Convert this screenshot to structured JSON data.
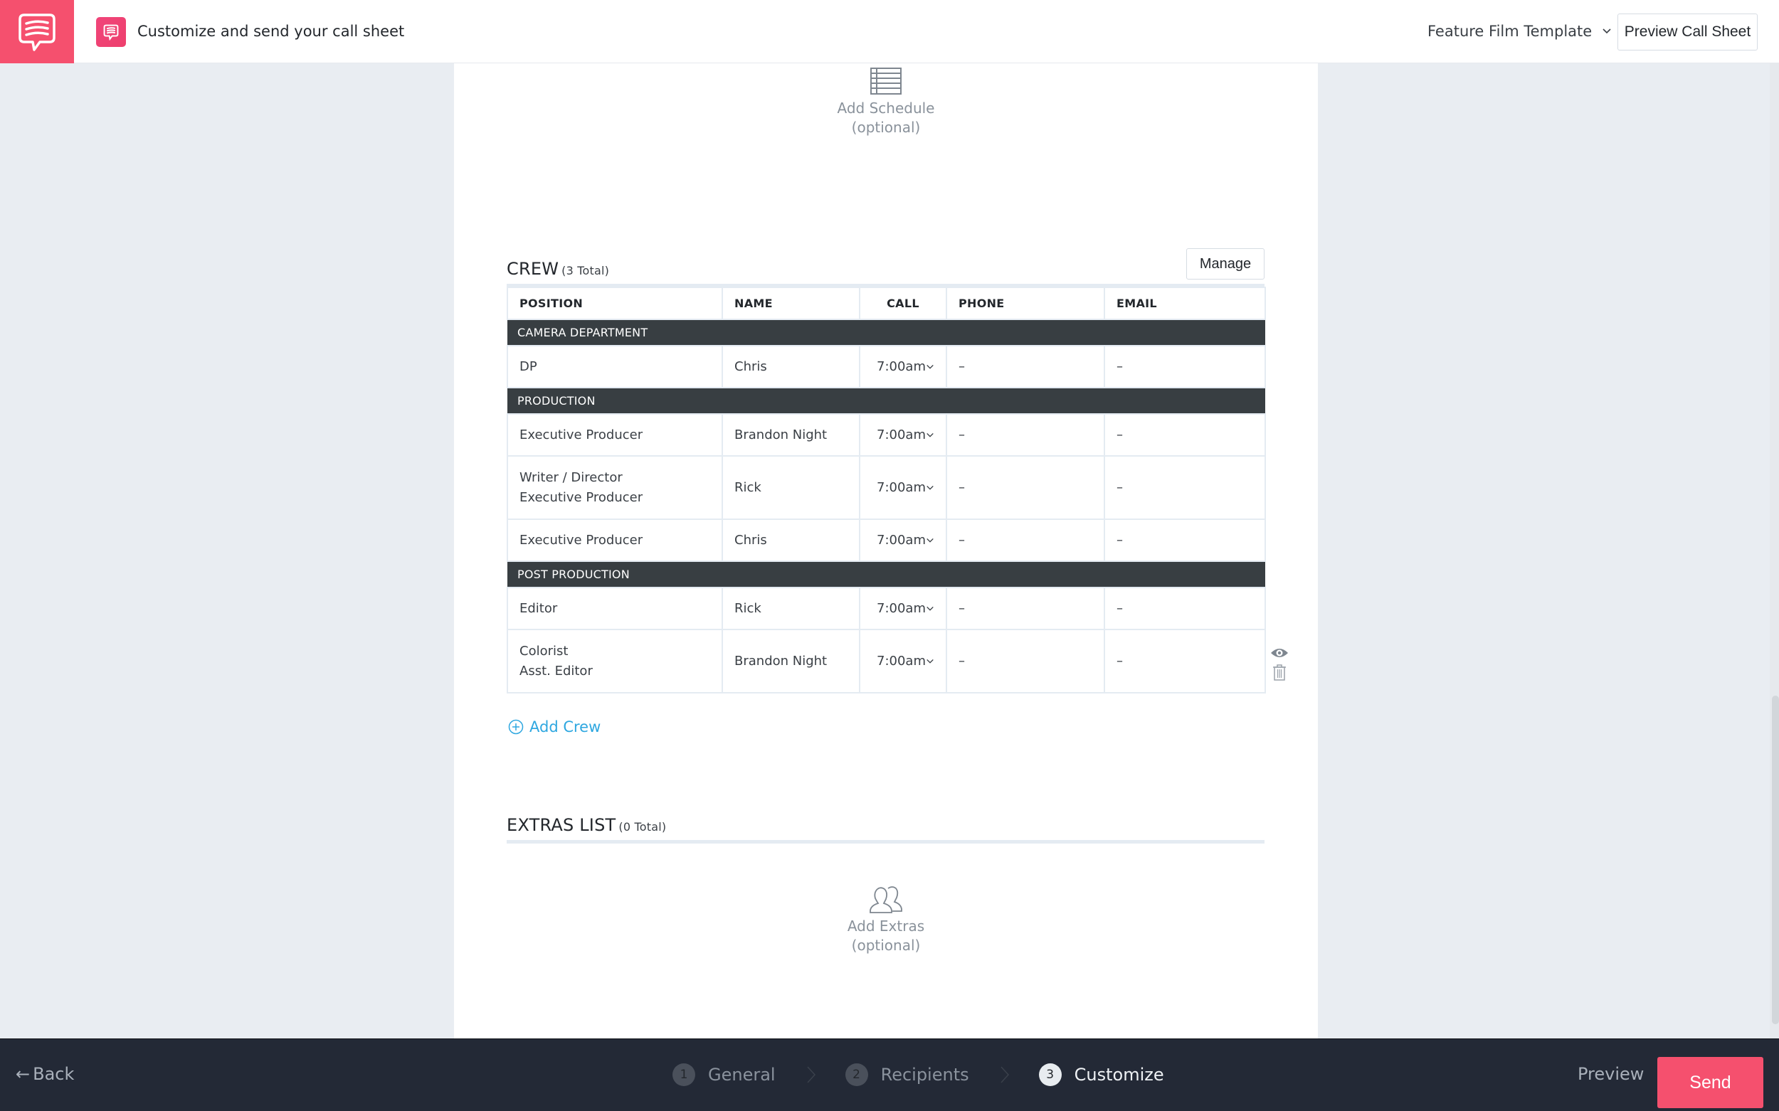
{
  "header": {
    "title": "Customize and send your call sheet",
    "template_select": "Feature Film Template",
    "preview_button": "Preview Call Sheet"
  },
  "schedule": {
    "icon": "schedule-table-icon",
    "label": "Add Schedule",
    "sub": "(optional)"
  },
  "crew": {
    "title": "CREW",
    "count": "(3 Total)",
    "manage_label": "Manage",
    "columns": [
      "POSITION",
      "NAME",
      "CALL",
      "PHONE",
      "EMAIL"
    ],
    "departments": [
      {
        "name": "CAMERA DEPARTMENT",
        "rows": [
          {
            "position": [
              "DP"
            ],
            "name": "Chris",
            "call": "7:00am",
            "phone": "–",
            "email": "–"
          }
        ]
      },
      {
        "name": "PRODUCTION",
        "rows": [
          {
            "position": [
              "Executive Producer"
            ],
            "name": "Brandon Night",
            "call": "7:00am",
            "phone": "–",
            "email": "–"
          },
          {
            "position": [
              "Writer / Director",
              "Executive Producer"
            ],
            "name": "Rick",
            "call": "7:00am",
            "phone": "–",
            "email": "–"
          },
          {
            "position": [
              "Executive Producer"
            ],
            "name": "Chris",
            "call": "7:00am",
            "phone": "–",
            "email": "–"
          }
        ]
      },
      {
        "name": "POST PRODUCTION",
        "rows": [
          {
            "position": [
              "Editor"
            ],
            "name": "Rick",
            "call": "7:00am",
            "phone": "–",
            "email": "–"
          },
          {
            "position": [
              "Colorist",
              "Asst. Editor"
            ],
            "name": "Brandon Night",
            "call": "7:00am",
            "phone": "–",
            "email": "–"
          }
        ]
      }
    ],
    "add_label": "Add Crew"
  },
  "extras": {
    "title": "EXTRAS LIST",
    "count": "(0 Total)",
    "label": "Add Extras",
    "sub": "(optional)"
  },
  "footer": {
    "back_label": "Back",
    "steps": [
      {
        "num": "1",
        "label": "General",
        "active": false
      },
      {
        "num": "2",
        "label": "Recipients",
        "active": false
      },
      {
        "num": "3",
        "label": "Customize",
        "active": true
      }
    ],
    "preview_label": "Preview",
    "send_label": "Send"
  },
  "colors": {
    "brand": "#f5506e",
    "link": "#2ea7e0",
    "dept_header": "#383e42",
    "footer_bg": "#232936"
  }
}
